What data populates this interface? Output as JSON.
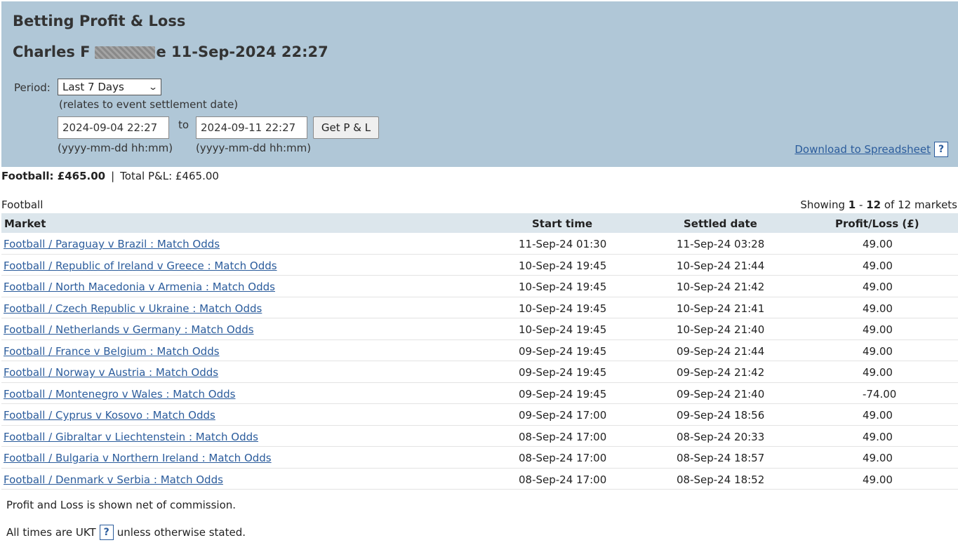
{
  "header": {
    "title": "Betting Profit & Loss",
    "account_first_name": "Charles F",
    "account_suffix": "e 11-Sep-2024 22:27"
  },
  "filters": {
    "period_label": "Period:",
    "period_selected": "Last 7 Days",
    "relates_note": "(relates to event settlement date)",
    "from_value": "2024-09-04 22:27",
    "to_label": "to",
    "to_value": "2024-09-11 22:27",
    "get_button": "Get P & L",
    "format_hint": "(yyyy-mm-dd hh:mm)",
    "download_link": "Download to Spreadsheet",
    "help_glyph": "?"
  },
  "summary": {
    "sport_total": "Football: £465.00",
    "separator": "|",
    "total": "Total P&L: £465.00"
  },
  "section": {
    "name": "Football",
    "showing_prefix": "Showing",
    "showing_from": "1",
    "showing_dash": "-",
    "showing_to": "12",
    "showing_suffix": "of 12 markets"
  },
  "table": {
    "columns": [
      "Market",
      "Start time",
      "Settled date",
      "Profit/Loss (£)"
    ],
    "rows": [
      {
        "market": "Football / Paraguay v Brazil : Match Odds",
        "start": "11-Sep-24 01:30",
        "settled": "11-Sep-24 03:28",
        "pl": "49.00"
      },
      {
        "market": "Football / Republic of Ireland v Greece : Match Odds",
        "start": "10-Sep-24 19:45",
        "settled": "10-Sep-24 21:44",
        "pl": "49.00"
      },
      {
        "market": "Football / North Macedonia v Armenia : Match Odds",
        "start": "10-Sep-24 19:45",
        "settled": "10-Sep-24 21:42",
        "pl": "49.00"
      },
      {
        "market": "Football / Czech Republic v Ukraine : Match Odds",
        "start": "10-Sep-24 19:45",
        "settled": "10-Sep-24 21:41",
        "pl": "49.00"
      },
      {
        "market": "Football / Netherlands v Germany : Match Odds",
        "start": "10-Sep-24 19:45",
        "settled": "10-Sep-24 21:40",
        "pl": "49.00"
      },
      {
        "market": "Football / France v Belgium : Match Odds",
        "start": "09-Sep-24 19:45",
        "settled": "09-Sep-24 21:44",
        "pl": "49.00"
      },
      {
        "market": "Football / Norway v Austria : Match Odds",
        "start": "09-Sep-24 19:45",
        "settled": "09-Sep-24 21:42",
        "pl": "49.00"
      },
      {
        "market": "Football / Montenegro v Wales : Match Odds",
        "start": "09-Sep-24 19:45",
        "settled": "09-Sep-24 21:40",
        "pl": "-74.00"
      },
      {
        "market": "Football / Cyprus v Kosovo : Match Odds",
        "start": "09-Sep-24 17:00",
        "settled": "09-Sep-24 18:56",
        "pl": "49.00"
      },
      {
        "market": "Football / Gibraltar v Liechtenstein : Match Odds",
        "start": "08-Sep-24 17:00",
        "settled": "08-Sep-24 20:33",
        "pl": "49.00"
      },
      {
        "market": "Football / Bulgaria v Northern Ireland : Match Odds",
        "start": "08-Sep-24 17:00",
        "settled": "08-Sep-24 18:57",
        "pl": "49.00"
      },
      {
        "market": "Football / Denmark v Serbia : Match Odds",
        "start": "08-Sep-24 17:00",
        "settled": "08-Sep-24 18:52",
        "pl": "49.00"
      }
    ]
  },
  "footer": {
    "commission_note": "Profit and Loss is shown net of commission.",
    "times_prefix": "All times are UKT",
    "times_suffix": "unless otherwise stated."
  },
  "colors": {
    "header_bg": "#b0c7d7",
    "table_header_bg": "#dce6ec",
    "link": "#2b5c9c"
  }
}
